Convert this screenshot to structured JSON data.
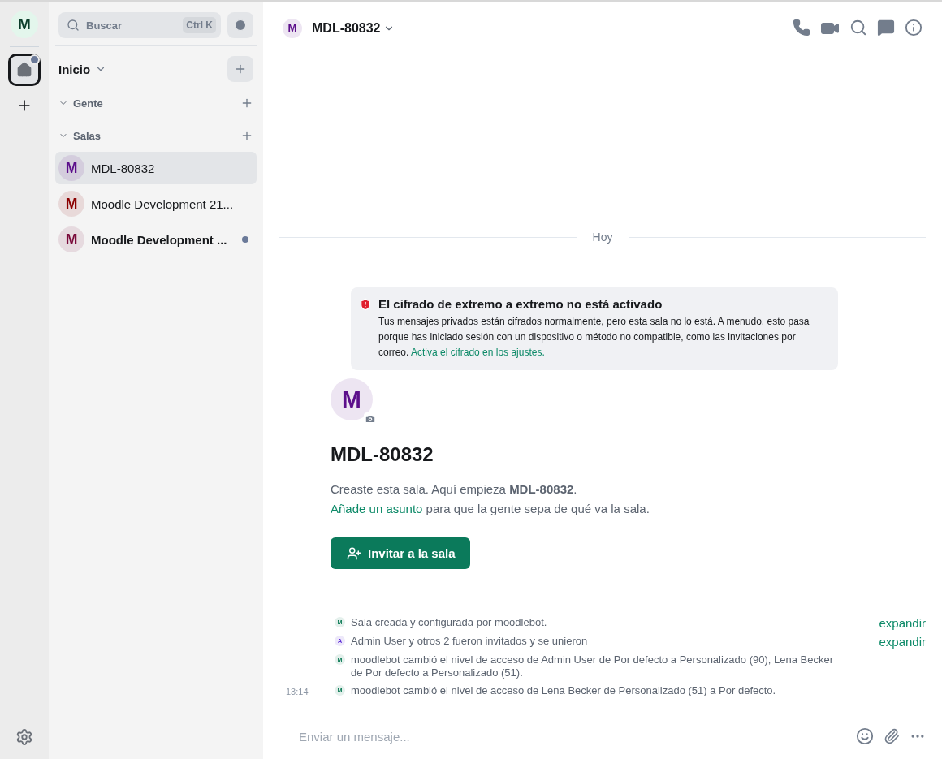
{
  "space_rail": {
    "avatar_letter": "M",
    "home_unread": true
  },
  "room_list": {
    "search": {
      "placeholder": "Buscar",
      "shortcut": "Ctrl K"
    },
    "title": "Inicio",
    "sections": [
      {
        "label": "Gente",
        "expanded": true
      },
      {
        "label": "Salas",
        "expanded": true
      }
    ],
    "rooms": [
      {
        "letter": "M",
        "name": "MDL-80832",
        "selected": true,
        "unread": false,
        "color": "#5c0f8b"
      },
      {
        "letter": "M",
        "name": "Moodle Development 21...",
        "selected": false,
        "unread": false,
        "color": "#8b0000"
      },
      {
        "letter": "M",
        "name": "Moodle Development ...",
        "selected": false,
        "unread": true,
        "color": "#7a0a3a"
      }
    ]
  },
  "header": {
    "letter": "M",
    "title": "MDL-80832"
  },
  "timeline": {
    "date_separator": "Hoy",
    "warning": {
      "title": "El cifrado de extremo a extremo no está activado",
      "body": "Tus mensajes privados están cifrados normalmente, pero esta sala no lo está. A menudo, esto pasa porque has iniciado sesión con un dispositivo o método no compatible, como las invitaciones por correo.",
      "link": "Activa el cifrado en los ajustes."
    },
    "intro": {
      "letter": "M",
      "title": "MDL-80832",
      "text": "Creaste esta sala. Aquí empieza **MDL-80832**.",
      "topic_link": "Añade un asunto",
      "topic_text": "para que la gente sepa de qué va la sala.",
      "invite_button": "Invitar a la sala"
    },
    "events": [
      {
        "letter": "M",
        "color": "#0b7a55",
        "text": "Sala creada y configurada por moodlebot.",
        "expand": "expandir"
      },
      {
        "letter": "A",
        "color": "#5b2bd6",
        "text": "Admin User y otros 2 fueron invitados y se unieron",
        "expand": "expandir"
      },
      {
        "letter": "M",
        "color": "#0b7a55",
        "text": "moodlebot cambió el nivel de acceso de Admin User de Por defecto a Personalizado (90), Lena Becker de Por defecto a Personalizado (51)."
      },
      {
        "letter": "M",
        "color": "#0b7a55",
        "text": "moodlebot cambió el nivel de acceso de Lena Becker de Personalizado (51) a Por defecto.",
        "time": "13:14"
      }
    ]
  },
  "composer": {
    "placeholder": "Enviar un mensaje..."
  }
}
